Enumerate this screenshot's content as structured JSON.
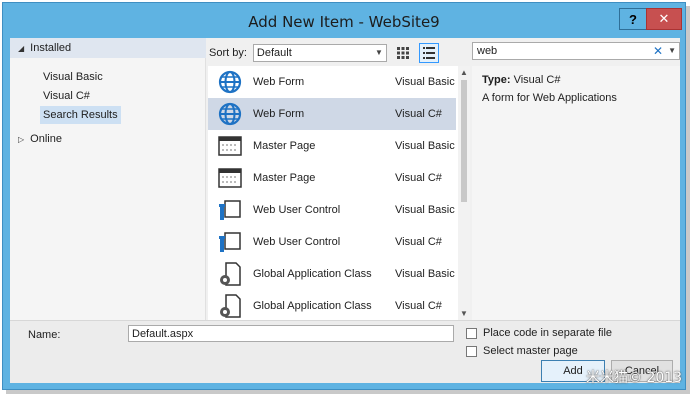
{
  "window": {
    "title": "Add New Item - WebSite9",
    "help_label": "?",
    "close_label": "✕"
  },
  "tree": {
    "installed_label": "Installed",
    "items": [
      "Visual Basic",
      "Visual C#",
      "Search Results"
    ],
    "online_label": "Online"
  },
  "toolbar": {
    "sort_label": "Sort by:",
    "sort_value": "Default"
  },
  "items": [
    {
      "name": "Web Form",
      "lang": "Visual Basic",
      "icon": "globe-icon"
    },
    {
      "name": "Web Form",
      "lang": "Visual C#",
      "icon": "globe-icon"
    },
    {
      "name": "Master Page",
      "lang": "Visual Basic",
      "icon": "master-page-icon"
    },
    {
      "name": "Master Page",
      "lang": "Visual C#",
      "icon": "master-page-icon"
    },
    {
      "name": "Web User Control",
      "lang": "Visual Basic",
      "icon": "user-control-icon"
    },
    {
      "name": "Web User Control",
      "lang": "Visual C#",
      "icon": "user-control-icon"
    },
    {
      "name": "Global Application Class",
      "lang": "Visual Basic",
      "icon": "gear-file-icon"
    },
    {
      "name": "Global Application Class",
      "lang": "Visual C#",
      "icon": "gear-file-icon"
    }
  ],
  "search": {
    "value": "web"
  },
  "details": {
    "type_label": "Type:",
    "type_value": "Visual C#",
    "description": "A form for Web Applications"
  },
  "bottom": {
    "name_label": "Name:",
    "name_value": "Default.aspx",
    "place_code_label": "Place code in separate file",
    "select_master_label": "Select master page",
    "add_label": "Add",
    "cancel_label": "Cancel"
  },
  "watermark": "米米猫© 2013",
  "colors": {
    "titlebar": "#5fb3e2",
    "close": "#c75050",
    "selection": "#cfd8e6",
    "accent": "#1e72c4"
  }
}
